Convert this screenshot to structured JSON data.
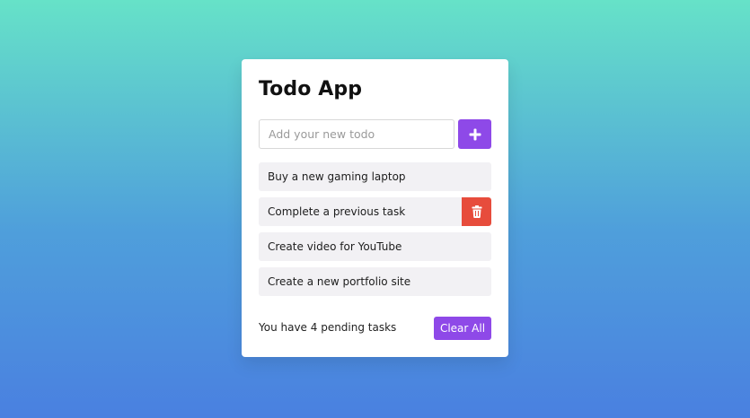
{
  "app": {
    "title": "Todo App"
  },
  "input": {
    "placeholder": "Add your new todo",
    "value": ""
  },
  "add_button": {
    "icon": "plus-icon"
  },
  "todos": [
    {
      "label": "Buy a new gaming laptop",
      "delete_visible": false
    },
    {
      "label": "Complete a previous task",
      "delete_visible": true
    },
    {
      "label": "Create video for YouTube",
      "delete_visible": false
    },
    {
      "label": "Create a new portfolio site",
      "delete_visible": false
    }
  ],
  "delete_button": {
    "icon": "trash-icon"
  },
  "footer": {
    "pending_text": "You have 4 pending tasks",
    "clear_label": "Clear All"
  },
  "colors": {
    "accent": "#8e49e8",
    "danger": "#e74c3c",
    "background_top": "#66e2c8",
    "background_bottom": "#4a80e0"
  }
}
